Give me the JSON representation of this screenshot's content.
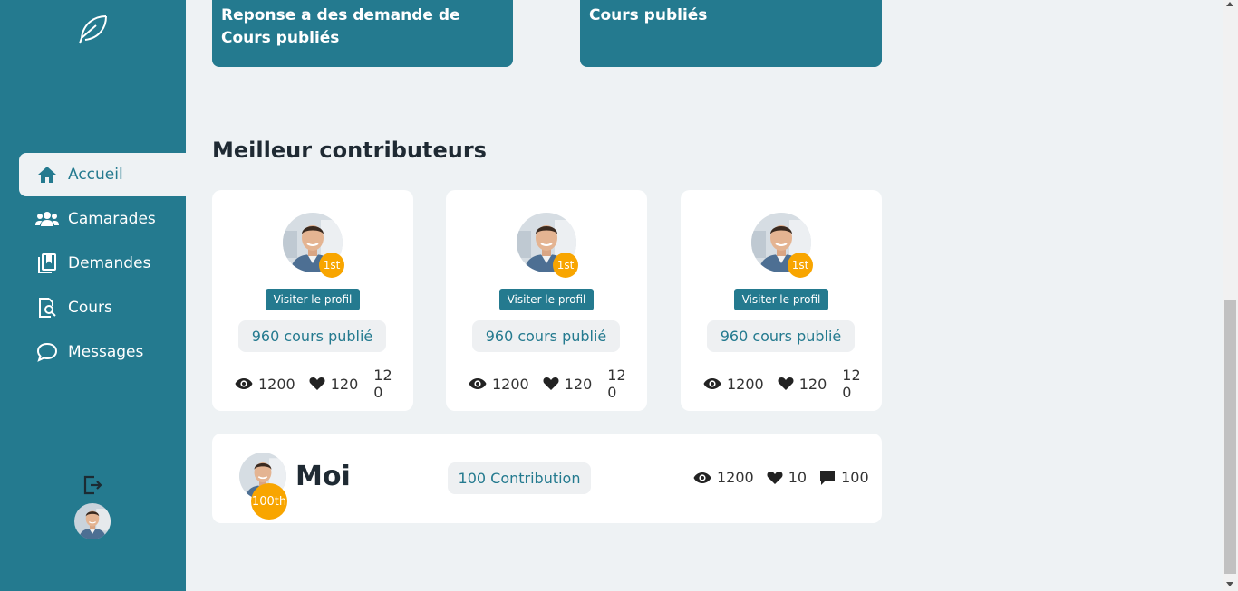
{
  "sidebar": {
    "items": [
      {
        "label": "Accueil",
        "icon": "home-icon",
        "active": true
      },
      {
        "label": "Camarades",
        "icon": "users-icon"
      },
      {
        "label": "Demandes",
        "icon": "bookmarks-icon"
      },
      {
        "label": "Cours",
        "icon": "search-document-icon"
      },
      {
        "label": "Messages",
        "icon": "chat-bubble-icon"
      }
    ]
  },
  "top_cards": [
    {
      "title": "Reponse a des demande de Cours publiés"
    },
    {
      "title": "Cours publiés"
    }
  ],
  "section_title": "Meilleur contributeurs",
  "contributors": [
    {
      "rank": "1st",
      "visit_label": "Visiter le profil",
      "courses": "960 cours publié",
      "views": "1200",
      "likes": "120",
      "comments": "12 0"
    },
    {
      "rank": "1st",
      "visit_label": "Visiter le profil",
      "courses": "960 cours publié",
      "views": "1200",
      "likes": "120",
      "comments": "12 0"
    },
    {
      "rank": "1st",
      "visit_label": "Visiter le profil",
      "courses": "960 cours publié",
      "views": "1200",
      "likes": "120",
      "comments": "12 0"
    }
  ],
  "me": {
    "name": "Moi",
    "rank": "100th",
    "contributions": "100 Contribution",
    "views": "1200",
    "likes": "10",
    "comments": "100"
  },
  "colors": {
    "primary": "#247a8f",
    "background": "#eef2f4",
    "rank_badge": "#f8a500"
  }
}
